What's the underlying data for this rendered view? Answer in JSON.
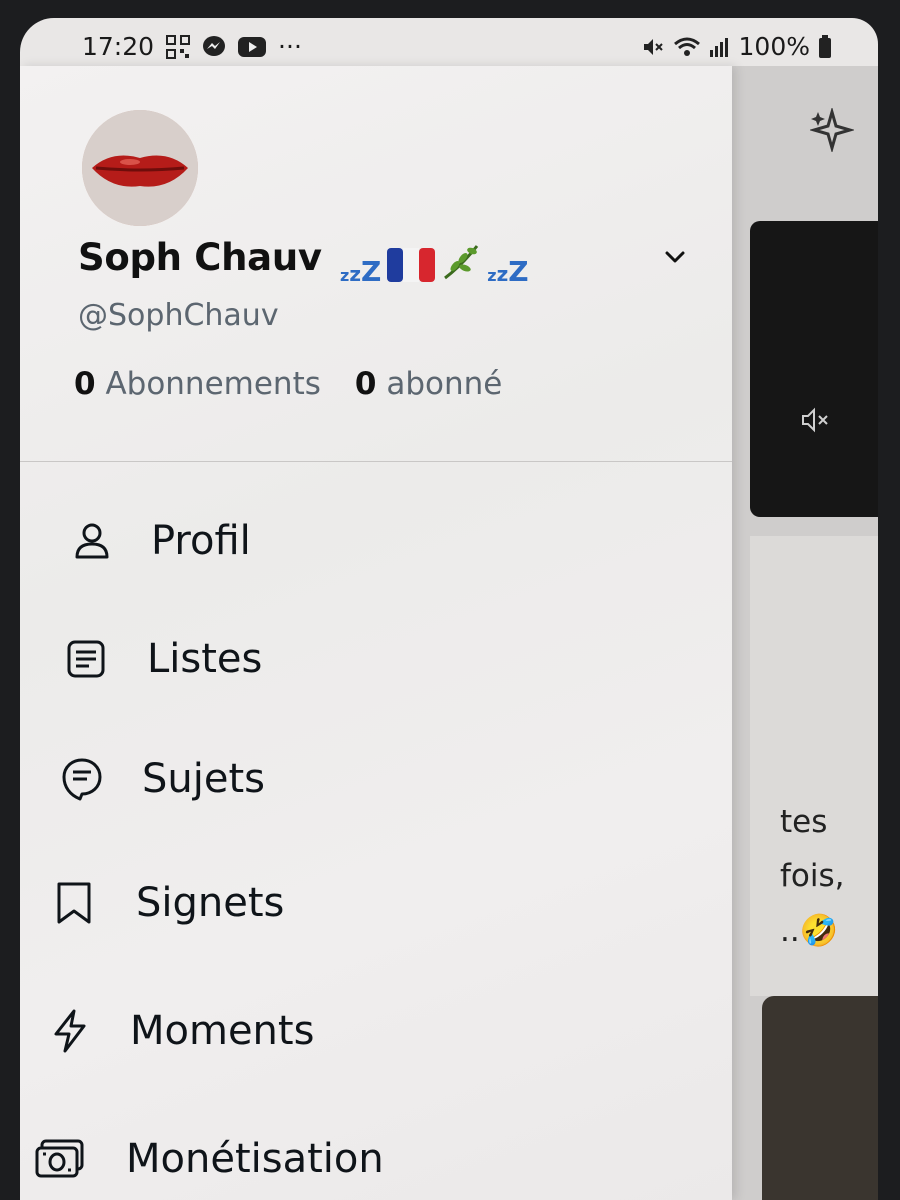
{
  "status_bar": {
    "time": "17:20",
    "dots": "···",
    "battery": "100%",
    "left_icons": [
      "qr-code-icon",
      "messenger-icon",
      "youtube-icon"
    ],
    "right_icons": [
      "mute-icon",
      "wifi-icon",
      "signal-icon",
      "battery-icon"
    ]
  },
  "profile": {
    "display_name": "Soph Chauv",
    "name_emojis": [
      "💤",
      "🇫🇷",
      "🌿",
      "💤"
    ],
    "handle": "@SophChauv",
    "following_count": "0",
    "following_label": "Abonnements",
    "followers_count": "0",
    "followers_label": "abonné"
  },
  "menu": {
    "items": [
      {
        "label": "Profil",
        "icon": "person-icon"
      },
      {
        "label": "Listes",
        "icon": "list-icon"
      },
      {
        "label": "Sujets",
        "icon": "topics-icon"
      },
      {
        "label": "Signets",
        "icon": "bookmark-icon"
      },
      {
        "label": "Moments",
        "icon": "lightning-icon"
      },
      {
        "label": "Monétisation",
        "icon": "money-icon"
      }
    ]
  },
  "feed": {
    "tweet_fragments": [
      "tes",
      "fois,",
      "..🤣"
    ]
  },
  "colors": {
    "text_primary": "#0f1419",
    "text_secondary": "#5c6670",
    "zzz_blue": "#2e6cc4"
  }
}
